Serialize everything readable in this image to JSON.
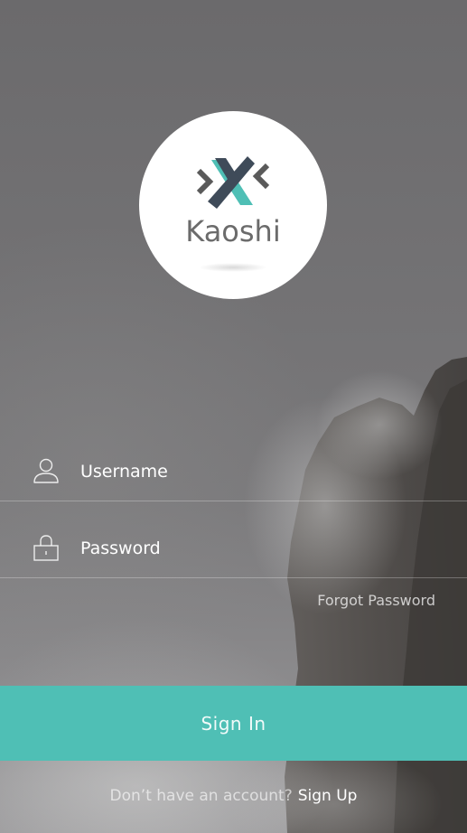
{
  "app": {
    "logo_text": "Kaoshi",
    "accent_color": "#4fbfb5"
  },
  "login": {
    "username": {
      "icon": "user-icon",
      "placeholder": "Username",
      "value": ""
    },
    "password": {
      "icon": "lock-icon",
      "placeholder": "Password",
      "value": ""
    },
    "forgot_label": "Forgot Password",
    "sign_in_label": "Sign In",
    "signup_prompt": "Don’t have an account?",
    "signup_label": "Sign Up"
  }
}
